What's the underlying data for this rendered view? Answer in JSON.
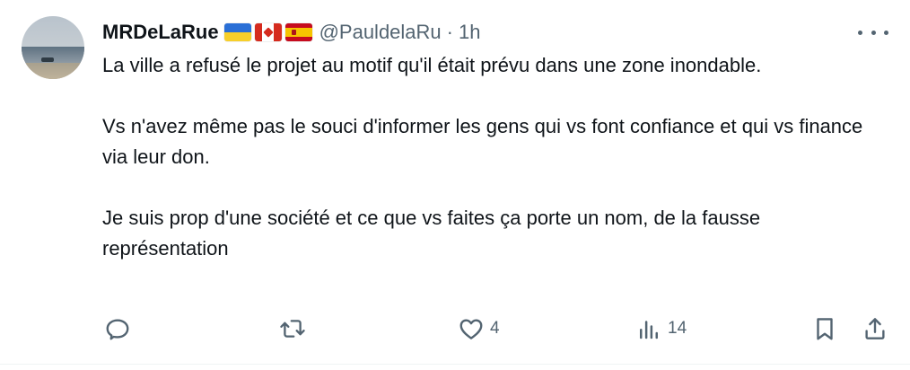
{
  "tweet": {
    "author": {
      "display_name": "MRDeLaRue",
      "flags": [
        "flag-ukraine",
        "flag-canada",
        "flag-spain"
      ],
      "handle": "@PauldelaRu",
      "separator": "·",
      "time": "1h"
    },
    "text": {
      "para1": "La ville a refusé le projet au motif qu'il était prévu dans une zone inondable.",
      "para2": "Vs n'avez même pas le souci d'informer les gens qui vs font confiance et qui vs finance via leur don.",
      "para3": "Je suis prop d'une société et ce que vs faites ça porte un nom, de la fausse représentation"
    },
    "actions": {
      "reply_count": "",
      "retweet_count": "",
      "like_count": "4",
      "views_count": "14"
    }
  },
  "colors": {
    "text_primary": "#0f1419",
    "text_secondary": "#536471"
  }
}
